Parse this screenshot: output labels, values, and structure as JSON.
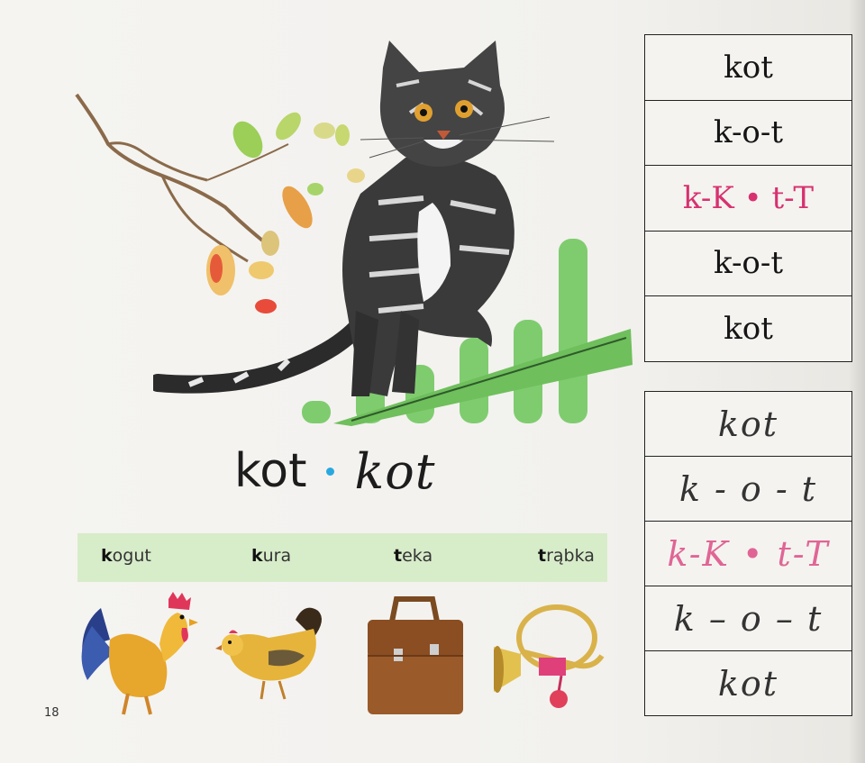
{
  "title": {
    "print": "kot",
    "cursive": "kot"
  },
  "panel_top": [
    {
      "text": "kot",
      "color": "#151515"
    },
    {
      "text": "k-o-t",
      "color": "#151515"
    },
    {
      "text": "k-K • t-T",
      "color": "#d8316f"
    },
    {
      "text": "k-o-t",
      "color": "#151515"
    },
    {
      "text": "kot",
      "color": "#151515"
    }
  ],
  "panel_bottom": [
    {
      "text": "kot"
    },
    {
      "text": "k - o - t"
    },
    {
      "text": "k-K • t-T"
    },
    {
      "text": "k – o – t"
    },
    {
      "text": "kot"
    }
  ],
  "words": [
    {
      "first": "k",
      "rest": "ogut"
    },
    {
      "first": "k",
      "rest": "ura"
    },
    {
      "first": "t",
      "rest": "eka"
    },
    {
      "first": "t",
      "rest": "rąbka"
    }
  ],
  "page_number": "18",
  "colors": {
    "accent_pink": "#d8316f",
    "dot_blue": "#29a8e0",
    "strip_green": "#d7ecc9",
    "fence_green": "#7fcc6f"
  },
  "illustrations": [
    "cat-on-fence",
    "branch-with-leaves",
    "rooster",
    "hen",
    "briefcase",
    "post-horn"
  ]
}
